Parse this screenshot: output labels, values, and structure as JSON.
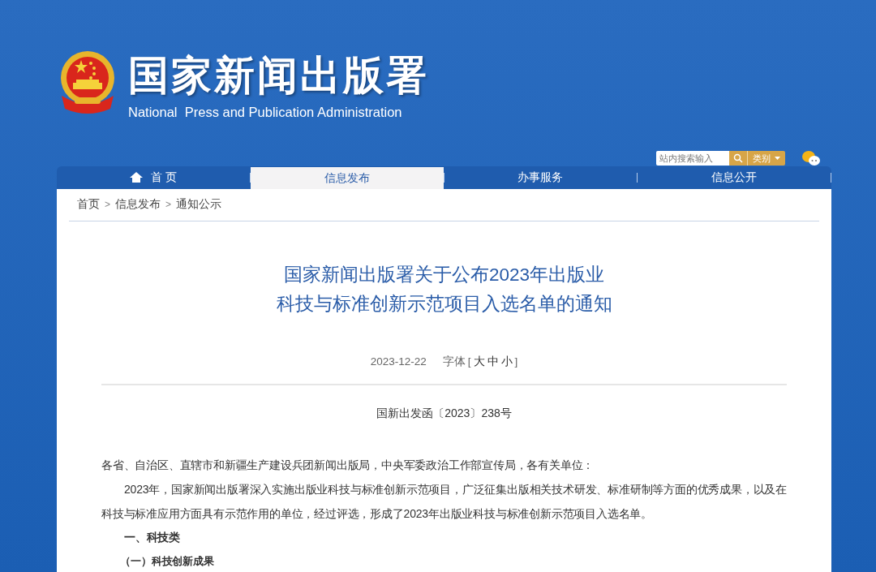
{
  "header": {
    "title": "国家新闻出版署",
    "subtitle": "National  Press and Publication Administration",
    "search": {
      "placeholder": "站内搜索输入"
    },
    "category_button": "类别"
  },
  "nav": [
    {
      "label": "首 页",
      "kind": "home",
      "selected": false
    },
    {
      "label": "信息发布",
      "kind": "text",
      "selected": true
    },
    {
      "label": "办事服务",
      "kind": "text",
      "selected": false
    },
    {
      "label": "信息公开",
      "kind": "text",
      "selected": false
    }
  ],
  "breadcrumb": {
    "items": [
      "首页",
      "信息发布",
      "通知公示"
    ],
    "separator": ">"
  },
  "article": {
    "title_lines": [
      "国家新闻出版署关于公布2023年出版业",
      "科技与标准创新示范项目入选名单的通知"
    ],
    "date": "2023-12-22",
    "font_size": {
      "label": "字体",
      "open": "[",
      "options": [
        "大",
        "中",
        "小"
      ],
      "close": "]"
    },
    "doc_number": "国新出发函〔2023〕238号",
    "salutation": "各省、自治区、直辖市和新疆生产建设兵团新闻出版局，中央军委政治工作部宣传局，各有关单位：",
    "paragraphs": [
      "2023年，国家新闻出版署深入实施出版业科技与标准创新示范项目，广泛征集出版相关技术研发、标准研制等方面的优秀成果，以及在科技与标准应用方面具有示范作用的单位，经过评选，形成了2023年出版业科技与标准创新示范项目入选名单。"
    ],
    "section_heading": "一、科技类",
    "subsection_heading": "（一）科技创新成果"
  }
}
